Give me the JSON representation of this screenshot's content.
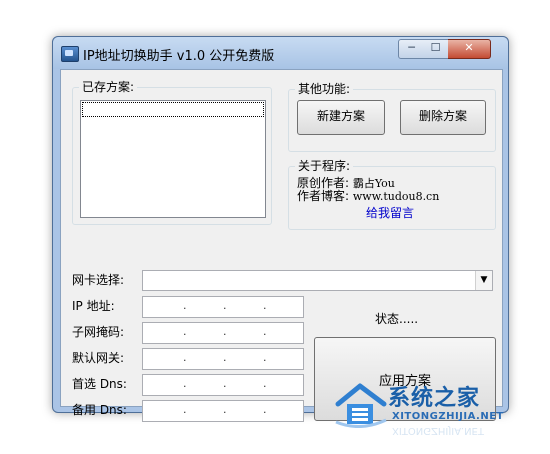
{
  "window": {
    "title": "IP地址切换助手 v1.0 公开免费版",
    "controls": {
      "minimize": "─",
      "maximize": "☐",
      "close": "✕"
    }
  },
  "saved_plans": {
    "label": "已存方案:",
    "items": [
      ""
    ]
  },
  "other_functions": {
    "label": "其他功能:",
    "new_plan_button": "新建方案",
    "delete_plan_button": "删除方案"
  },
  "about": {
    "label": "关于程序:",
    "author_key": "原创作者:",
    "author_value": "霸占You",
    "blog_key": "作者博客:",
    "blog_value": "www.tudou8.cn",
    "message_link": "给我留言"
  },
  "form": {
    "nic_label": "网卡选择:",
    "nic_value": "",
    "ip_label": "IP  地址:",
    "subnet_label": "子网掩码:",
    "gateway_label": "默认网关:",
    "dns1_label": "首选 Dns:",
    "dns2_label": "备用 Dns:",
    "dot": "."
  },
  "status_text": "状态.....",
  "apply_button": "应用方案",
  "watermark": {
    "title": "系统之家",
    "subtitle": "XITONGZHIJIA.NET",
    "reflection": "XITONGZHIJIA.NET"
  },
  "colors": {
    "window_frame": "#aac4e6",
    "client_bg": "#f0f0f0",
    "link": "#0000cc",
    "watermark_blue": "#1a5fa8"
  }
}
